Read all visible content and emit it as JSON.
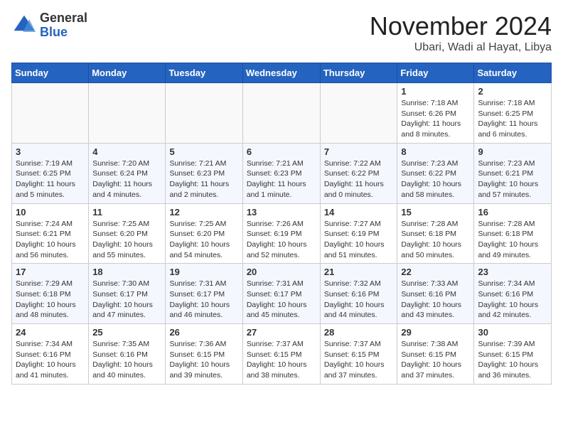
{
  "logo": {
    "general": "General",
    "blue": "Blue"
  },
  "header": {
    "month": "November 2024",
    "location": "Ubari, Wadi al Hayat, Libya"
  },
  "weekdays": [
    "Sunday",
    "Monday",
    "Tuesday",
    "Wednesday",
    "Thursday",
    "Friday",
    "Saturday"
  ],
  "weeks": [
    [
      {
        "day": "",
        "info": ""
      },
      {
        "day": "",
        "info": ""
      },
      {
        "day": "",
        "info": ""
      },
      {
        "day": "",
        "info": ""
      },
      {
        "day": "",
        "info": ""
      },
      {
        "day": "1",
        "info": "Sunrise: 7:18 AM\nSunset: 6:26 PM\nDaylight: 11 hours and 8 minutes."
      },
      {
        "day": "2",
        "info": "Sunrise: 7:18 AM\nSunset: 6:25 PM\nDaylight: 11 hours and 6 minutes."
      }
    ],
    [
      {
        "day": "3",
        "info": "Sunrise: 7:19 AM\nSunset: 6:25 PM\nDaylight: 11 hours and 5 minutes."
      },
      {
        "day": "4",
        "info": "Sunrise: 7:20 AM\nSunset: 6:24 PM\nDaylight: 11 hours and 4 minutes."
      },
      {
        "day": "5",
        "info": "Sunrise: 7:21 AM\nSunset: 6:23 PM\nDaylight: 11 hours and 2 minutes."
      },
      {
        "day": "6",
        "info": "Sunrise: 7:21 AM\nSunset: 6:23 PM\nDaylight: 11 hours and 1 minute."
      },
      {
        "day": "7",
        "info": "Sunrise: 7:22 AM\nSunset: 6:22 PM\nDaylight: 11 hours and 0 minutes."
      },
      {
        "day": "8",
        "info": "Sunrise: 7:23 AM\nSunset: 6:22 PM\nDaylight: 10 hours and 58 minutes."
      },
      {
        "day": "9",
        "info": "Sunrise: 7:23 AM\nSunset: 6:21 PM\nDaylight: 10 hours and 57 minutes."
      }
    ],
    [
      {
        "day": "10",
        "info": "Sunrise: 7:24 AM\nSunset: 6:21 PM\nDaylight: 10 hours and 56 minutes."
      },
      {
        "day": "11",
        "info": "Sunrise: 7:25 AM\nSunset: 6:20 PM\nDaylight: 10 hours and 55 minutes."
      },
      {
        "day": "12",
        "info": "Sunrise: 7:25 AM\nSunset: 6:20 PM\nDaylight: 10 hours and 54 minutes."
      },
      {
        "day": "13",
        "info": "Sunrise: 7:26 AM\nSunset: 6:19 PM\nDaylight: 10 hours and 52 minutes."
      },
      {
        "day": "14",
        "info": "Sunrise: 7:27 AM\nSunset: 6:19 PM\nDaylight: 10 hours and 51 minutes."
      },
      {
        "day": "15",
        "info": "Sunrise: 7:28 AM\nSunset: 6:18 PM\nDaylight: 10 hours and 50 minutes."
      },
      {
        "day": "16",
        "info": "Sunrise: 7:28 AM\nSunset: 6:18 PM\nDaylight: 10 hours and 49 minutes."
      }
    ],
    [
      {
        "day": "17",
        "info": "Sunrise: 7:29 AM\nSunset: 6:18 PM\nDaylight: 10 hours and 48 minutes."
      },
      {
        "day": "18",
        "info": "Sunrise: 7:30 AM\nSunset: 6:17 PM\nDaylight: 10 hours and 47 minutes."
      },
      {
        "day": "19",
        "info": "Sunrise: 7:31 AM\nSunset: 6:17 PM\nDaylight: 10 hours and 46 minutes."
      },
      {
        "day": "20",
        "info": "Sunrise: 7:31 AM\nSunset: 6:17 PM\nDaylight: 10 hours and 45 minutes."
      },
      {
        "day": "21",
        "info": "Sunrise: 7:32 AM\nSunset: 6:16 PM\nDaylight: 10 hours and 44 minutes."
      },
      {
        "day": "22",
        "info": "Sunrise: 7:33 AM\nSunset: 6:16 PM\nDaylight: 10 hours and 43 minutes."
      },
      {
        "day": "23",
        "info": "Sunrise: 7:34 AM\nSunset: 6:16 PM\nDaylight: 10 hours and 42 minutes."
      }
    ],
    [
      {
        "day": "24",
        "info": "Sunrise: 7:34 AM\nSunset: 6:16 PM\nDaylight: 10 hours and 41 minutes."
      },
      {
        "day": "25",
        "info": "Sunrise: 7:35 AM\nSunset: 6:16 PM\nDaylight: 10 hours and 40 minutes."
      },
      {
        "day": "26",
        "info": "Sunrise: 7:36 AM\nSunset: 6:15 PM\nDaylight: 10 hours and 39 minutes."
      },
      {
        "day": "27",
        "info": "Sunrise: 7:37 AM\nSunset: 6:15 PM\nDaylight: 10 hours and 38 minutes."
      },
      {
        "day": "28",
        "info": "Sunrise: 7:37 AM\nSunset: 6:15 PM\nDaylight: 10 hours and 37 minutes."
      },
      {
        "day": "29",
        "info": "Sunrise: 7:38 AM\nSunset: 6:15 PM\nDaylight: 10 hours and 37 minutes."
      },
      {
        "day": "30",
        "info": "Sunrise: 7:39 AM\nSunset: 6:15 PM\nDaylight: 10 hours and 36 minutes."
      }
    ]
  ]
}
